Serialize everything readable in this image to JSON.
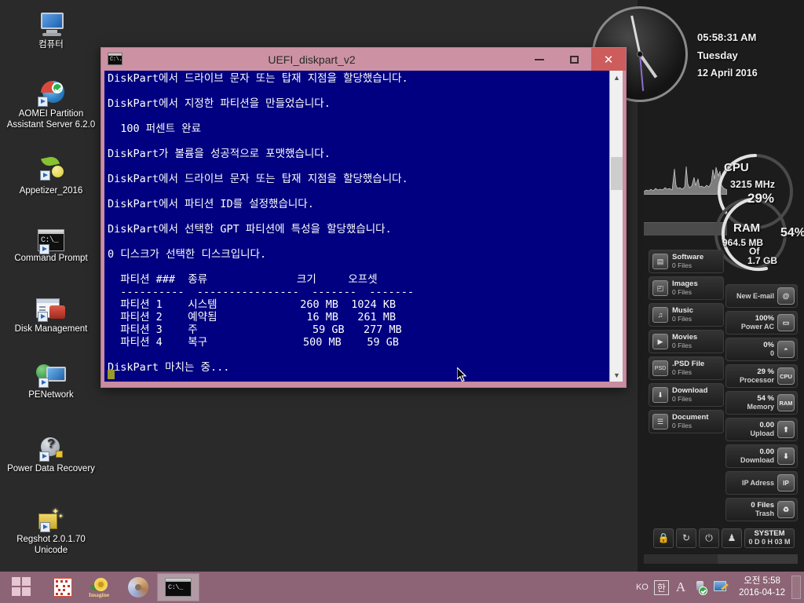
{
  "desktop": {
    "icons": [
      {
        "label": "컴퓨터",
        "icon": "computer-icon",
        "shortcut": false
      },
      {
        "label": "AOMEI Partition\nAssistant Server 6.2.0",
        "icon": "aomei-partition-icon",
        "shortcut": true
      },
      {
        "label": "Appetizer_2016",
        "icon": "appetizer-icon",
        "shortcut": true
      },
      {
        "label": "Command Prompt",
        "icon": "command-prompt-icon",
        "shortcut": true
      },
      {
        "label": "Disk Management",
        "icon": "disk-management-icon",
        "shortcut": true
      },
      {
        "label": "PENetwork",
        "icon": "penetwork-icon",
        "shortcut": true
      },
      {
        "label": "Power Data Recovery",
        "icon": "power-data-recovery-icon",
        "shortcut": true
      },
      {
        "label": "Regshot 2.0.1.70\nUnicode",
        "icon": "regshot-icon",
        "shortcut": true
      }
    ]
  },
  "console_window": {
    "title": "UEFI_diskpart_v2",
    "icon": "console-window-icon",
    "minimize_label": "–",
    "maximize_label": "☐",
    "close_label": "✕",
    "scrollbar": {
      "up_arrow": "˄",
      "down_arrow": "˅",
      "thumb_position_percent": 27
    },
    "lines": [
      "DiskPart에서 드라이브 문자 또는 탑재 지점을 할당했습니다.",
      "",
      "DiskPart에서 지정한 파티션을 만들었습니다.",
      "",
      "  100 퍼센트 완료",
      "",
      "DiskPart가 볼륨을 성공적으로 포맷했습니다.",
      "",
      "DiskPart에서 드라이브 문자 또는 탑재 지점을 할당했습니다.",
      "",
      "DiskPart에서 파티션 ID를 설정했습니다.",
      "",
      "DiskPart에서 선택한 GPT 파티션에 특성을 할당했습니다.",
      "",
      "0 디스크가 선택한 디스크입니다.",
      "",
      "  파티션 ###  종류              크기     오프셋",
      "  ----------  ----------------  -------  -------",
      "  파티션 1    시스템             260 MB  1024 KB",
      "  파티션 2    예약됨              16 MB   261 MB",
      "  파티션 3    주                  59 GB   277 MB",
      "  파티션 4    복구               500 MB    59 GB",
      "",
      "DiskPart 마치는 중..."
    ],
    "partition_table": {
      "headers": [
        "파티션 ###",
        "종류",
        "크기",
        "오프셋"
      ],
      "rows": [
        [
          "파티션 1",
          "시스템",
          "260 MB",
          "1024 KB"
        ],
        [
          "파티션 2",
          "예약됨",
          "16 MB",
          "261 MB"
        ],
        [
          "파티션 3",
          "주",
          "59 GB",
          "277 MB"
        ],
        [
          "파티션 4",
          "복구",
          "500 MB",
          "59 GB"
        ]
      ]
    },
    "colors": {
      "background": "#000080",
      "text": "#ffffff",
      "titlebar": "#cc92a4",
      "close": "#cd5c5c"
    }
  },
  "gadget_panel": {
    "clock": {
      "time": "05:58:31 AM",
      "weekday": "Tuesday",
      "date": "12 April 2016"
    },
    "cpu": {
      "label": "CPU",
      "frequency": "3215 MHz",
      "percent": "29%",
      "percent_value": 29
    },
    "ram": {
      "label": "RAM",
      "used": "964.5 MB",
      "of": "Of",
      "total": "1.7 GB",
      "percent": "54%",
      "percent_value": 54
    },
    "file_categories": [
      {
        "name": "Software",
        "count": "0 Files",
        "icon": "software-icon",
        "glyph": "▤"
      },
      {
        "name": "Images",
        "count": "0 Files",
        "icon": "images-icon",
        "glyph": "◰"
      },
      {
        "name": "Music",
        "count": "0 Files",
        "icon": "music-icon",
        "glyph": "♫"
      },
      {
        "name": "Movies",
        "count": "0 Files",
        "icon": "movies-icon",
        "glyph": "▶"
      },
      {
        "name": ".PSD File",
        "count": "0 Files",
        "icon": "psd-file-icon",
        "glyph": "PSD"
      },
      {
        "name": "Download",
        "count": "0 Files",
        "icon": "download-icon",
        "glyph": "⬇"
      },
      {
        "name": "Document",
        "count": "0 Files",
        "icon": "document-icon",
        "glyph": "☰"
      }
    ],
    "status_items": [
      {
        "line1": "",
        "line2": "New E-mail",
        "icon": "email-icon",
        "glyph": "@"
      },
      {
        "line1": "100%",
        "line2": "Power AC",
        "icon": "power-ac-icon",
        "glyph": "▭"
      },
      {
        "line1": "0%",
        "line2": "0",
        "icon": "wifi-icon",
        "glyph": "◓"
      },
      {
        "line1": "29 %",
        "line2": "Processor",
        "icon": "cpu-icon",
        "glyph": "CPU"
      },
      {
        "line1": "54 %",
        "line2": "Memory",
        "icon": "ram-icon",
        "glyph": "RAM"
      },
      {
        "line1": "0.00",
        "line2": "Upload",
        "icon": "upload-icon",
        "glyph": "⬆"
      },
      {
        "line1": "0.00",
        "line2": "Download",
        "icon": "download-arrow-icon",
        "glyph": "⬇"
      },
      {
        "line1": "",
        "line2": "IP Adress",
        "icon": "ip-address-icon",
        "glyph": "IP"
      },
      {
        "line1": "0 Files",
        "line2": "Trash",
        "icon": "trash-icon",
        "glyph": "Ὕ1"
      }
    ],
    "controls": [
      {
        "name": "lock-button",
        "glyph": "ὑ2"
      },
      {
        "name": "restart-button",
        "glyph": "↻"
      },
      {
        "name": "power-button",
        "glyph": "⏻"
      },
      {
        "name": "user-button",
        "glyph": "♟"
      }
    ],
    "system": {
      "label": "SYSTEM",
      "uptime": "0 D 0 H 03 M"
    }
  },
  "taskbar": {
    "start_button": "start-button",
    "items": [
      {
        "name": "qr-app-icon",
        "label": ""
      },
      {
        "name": "imagine-app-icon",
        "label": "Imagine"
      },
      {
        "name": "disc-app-icon",
        "label": ""
      },
      {
        "name": "command-prompt-taskbar-icon",
        "label": "",
        "active": true
      }
    ],
    "tray": {
      "language": "KO",
      "ime": "한",
      "ime_mode": "A",
      "icons": [
        {
          "name": "usb-safely-remove-icon"
        },
        {
          "name": "display-settings-icon"
        }
      ],
      "clock_time": "오전 5:58",
      "clock_date": "2016-04-12"
    }
  }
}
